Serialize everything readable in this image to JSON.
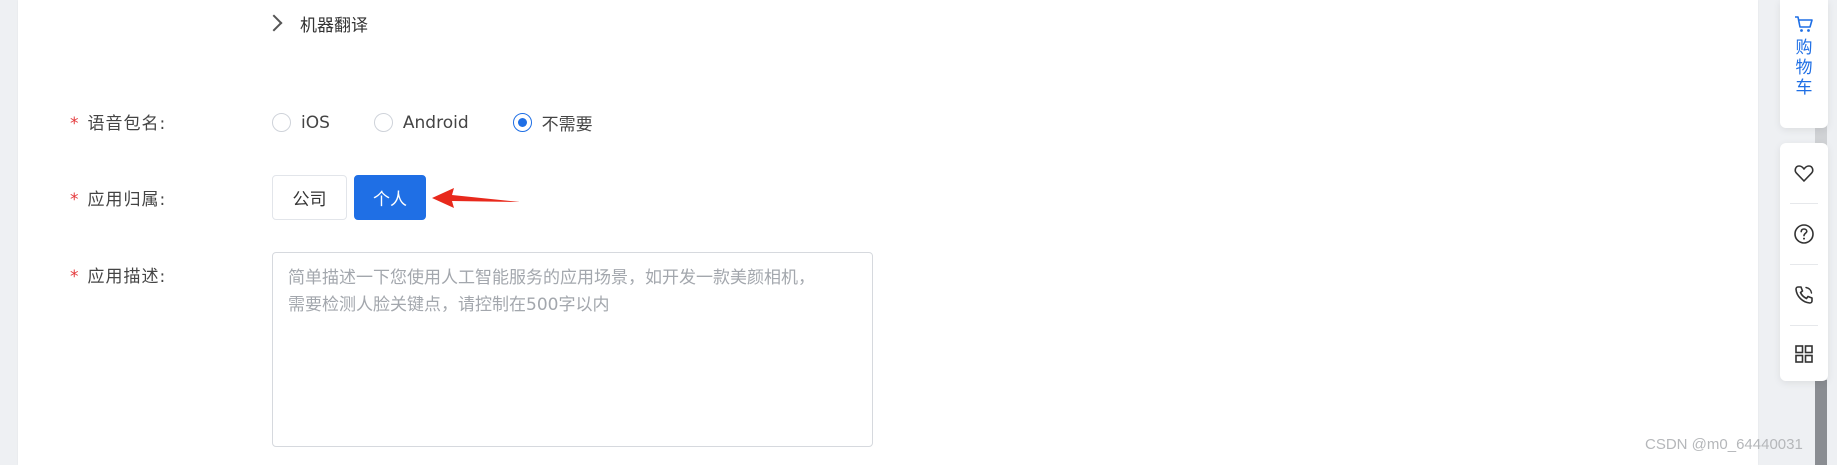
{
  "form": {
    "collapse": {
      "label": "机器翻译"
    },
    "voice_package": {
      "required_mark": "*",
      "label": "语音包名:",
      "options": [
        "iOS",
        "Android",
        "不需要"
      ],
      "selected": "不需要"
    },
    "ownership": {
      "required_mark": "*",
      "label": "应用归属:",
      "options": [
        "公司",
        "个人"
      ],
      "selected": "个人"
    },
    "description": {
      "required_mark": "*",
      "label": "应用描述:",
      "placeholder_line1": "简单描述一下您使用人工智能服务的应用场景，如开发一款美颜相机，",
      "placeholder_line2": "需要检测人脸关键点，请控制在500字以内"
    }
  },
  "sidebar": {
    "cart_label": [
      "购",
      "物",
      "车"
    ],
    "tools": [
      "heart-icon",
      "help-icon",
      "phone-icon",
      "grid-icon"
    ]
  },
  "watermark": "CSDN @m0_64440031",
  "colors": {
    "primary": "#1f6fe5",
    "required": "#e4393c",
    "arrow": "#e8291c"
  }
}
